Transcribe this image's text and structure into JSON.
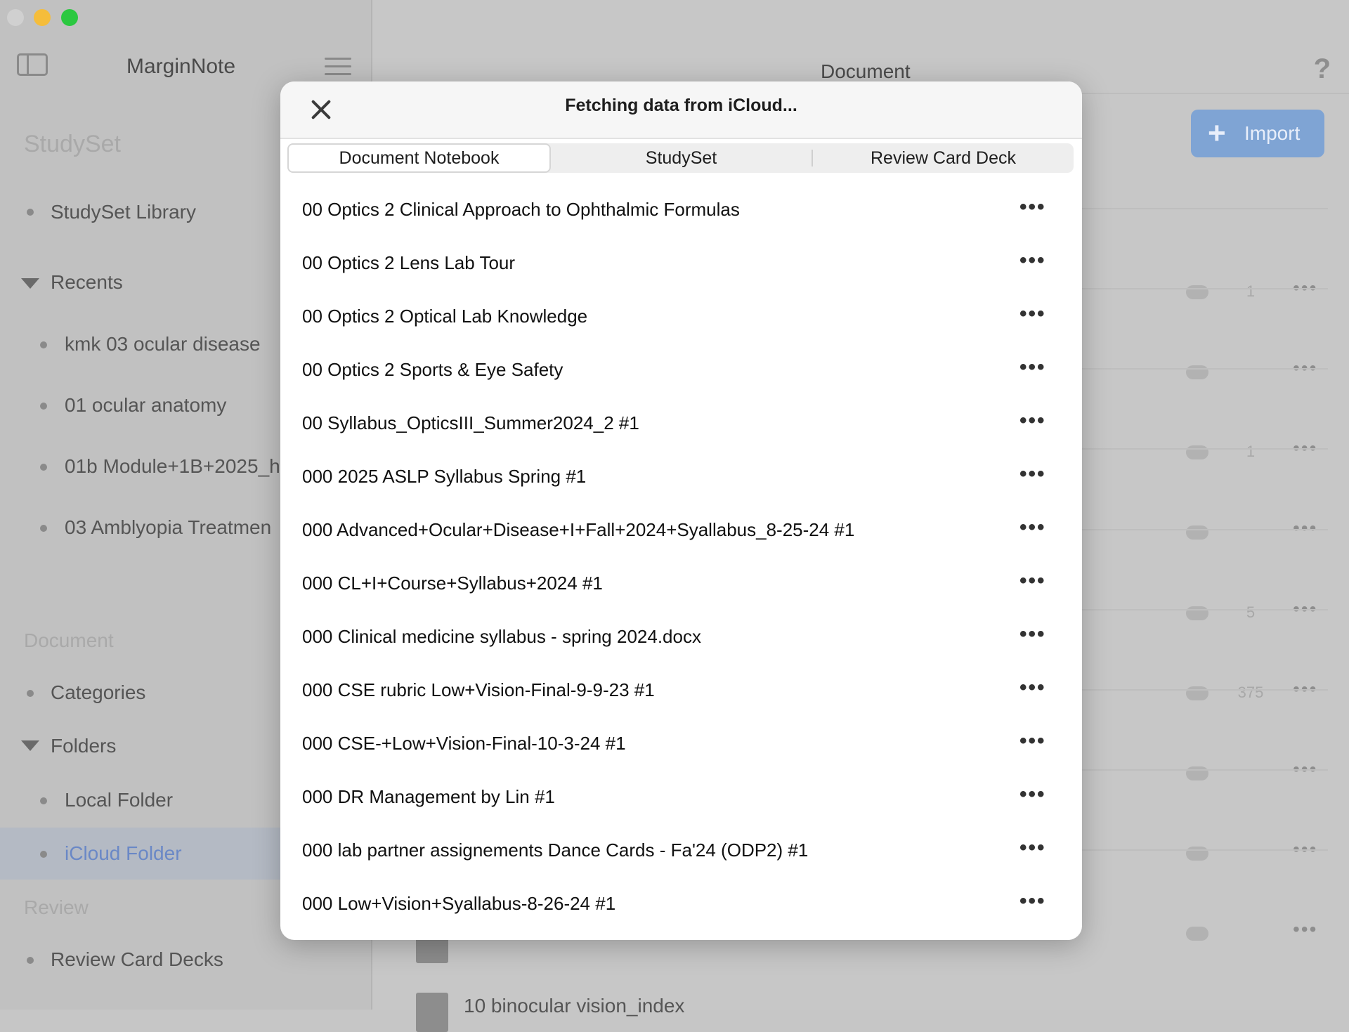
{
  "app": {
    "title": "MarginNote"
  },
  "sidebar": {
    "studyset_header": "StudySet",
    "studyset_library": "StudySet Library",
    "recents_label": "Recents",
    "recents": [
      "kmk 03 ocular disease",
      "01 ocular anatomy",
      "01b Module+1B+2025_h",
      "03 Amblyopia Treatmen"
    ],
    "document_header": "Document",
    "categories": "Categories",
    "folders_label": "Folders",
    "local_folder": "Local Folder",
    "icloud_folder": "iCloud Folder",
    "review_header": "Review",
    "review_card_decks": "Review Card Decks"
  },
  "main": {
    "title": "Document",
    "help": "?",
    "import_label": "Import",
    "rows": [
      {
        "count": "1"
      },
      {
        "count": ""
      },
      {
        "count": "1"
      },
      {
        "count": ""
      },
      {
        "count": "5"
      },
      {
        "count": "375"
      },
      {
        "count": ""
      },
      {
        "count": ""
      },
      {
        "count": ""
      }
    ],
    "partial_doc": "10 binocular vision_index"
  },
  "modal": {
    "title": "Fetching data from iCloud...",
    "tabs": [
      "Document Notebook",
      "StudySet",
      "Review Card Deck"
    ],
    "selected_tab": "Document Notebook",
    "items": [
      "00 Optics 2 Clinical Approach to Ophthalmic Formulas",
      "00 Optics 2 Lens Lab Tour",
      "00 Optics 2 Optical Lab Knowledge",
      "00 Optics 2 Sports & Eye Safety",
      "00 Syllabus_OpticsIII_Summer2024_2 #1",
      "000 2025 ASLP Syllabus Spring #1",
      "000 Advanced+Ocular+Disease+I+Fall+2024+Syallabus_8-25-24 #1",
      "000 CL+I+Course+Syllabus+2024 #1",
      "000 Clinical medicine syllabus - spring 2024.docx",
      "000 CSE rubric Low+Vision-Final-9-9-23 #1",
      "000 CSE-+Low+Vision-Final-10-3-24 #1",
      "000 DR Management by Lin  #1",
      "000 lab partner assignements Dance Cards - Fa'24 (ODP2) #1",
      "000 Low+Vision+Syallabus-8-26-24 #1"
    ],
    "more_glyph": "•••"
  }
}
